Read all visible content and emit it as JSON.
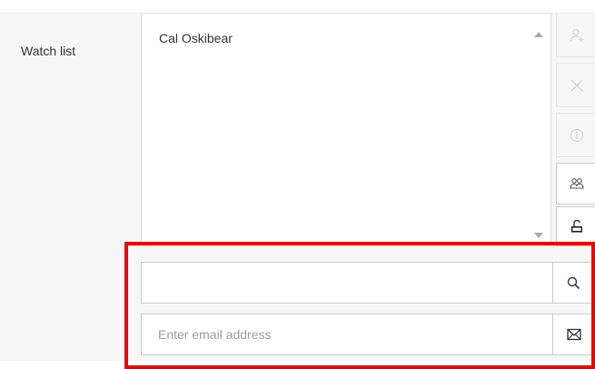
{
  "watch_list": {
    "label": "Watch list",
    "items": [
      "Cal Oskibear"
    ]
  },
  "side_buttons": [
    {
      "name": "add-watcher-button",
      "icon": "add-person-icon",
      "enabled": false
    },
    {
      "name": "remove-watcher-button",
      "icon": "close-icon",
      "enabled": false
    },
    {
      "name": "watcher-info-button",
      "icon": "info-icon",
      "enabled": false
    },
    {
      "name": "group-watchers-button",
      "icon": "group-icon",
      "enabled": true
    },
    {
      "name": "unlock-button",
      "icon": "unlock-icon",
      "enabled": true
    }
  ],
  "search": {
    "value": "",
    "placeholder": "",
    "icon": "search-icon"
  },
  "email": {
    "value": "",
    "placeholder": "Enter email address",
    "icon": "envelope-icon"
  },
  "colors": {
    "highlight": "#ee0000",
    "background": "#f7f7f7",
    "border": "#cccccc"
  }
}
